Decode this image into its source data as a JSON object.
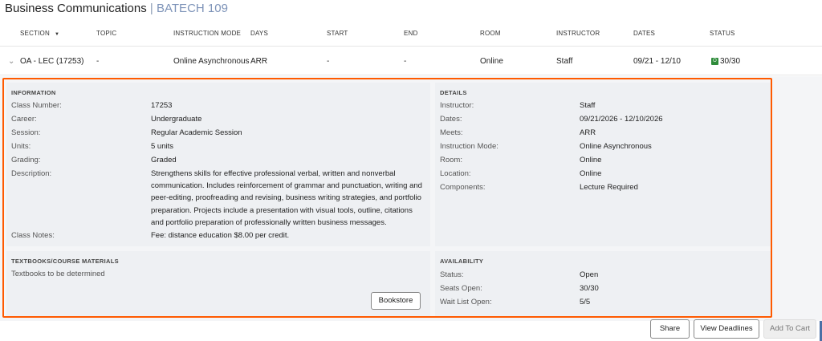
{
  "course": {
    "name": "Business Communications",
    "separator": "|",
    "code": "BATECH 109"
  },
  "columns": {
    "section": "SECTION",
    "topic": "TOPIC",
    "instruction_mode": "INSTRUCTION MODE",
    "days": "DAYS",
    "start": "START",
    "end": "END",
    "room": "ROOM",
    "instructor": "INSTRUCTOR",
    "dates": "DATES",
    "status": "STATUS"
  },
  "row": {
    "section": "OA - LEC (17253)",
    "topic": "-",
    "instruction_mode": "Online Asynchronous",
    "days": "ARR",
    "start": "-",
    "end": "-",
    "room": "Online",
    "instructor": "Staff",
    "dates": "09/21 - 12/10",
    "status_icon_letter": "O",
    "status": "30/30"
  },
  "information": {
    "title": "INFORMATION",
    "class_number_label": "Class Number:",
    "class_number": "17253",
    "career_label": "Career:",
    "career": "Undergraduate",
    "session_label": "Session:",
    "session": "Regular Academic Session",
    "units_label": "Units:",
    "units": "5 units",
    "grading_label": "Grading:",
    "grading": "Graded",
    "description_label": "Description:",
    "description": "Strengthens skills for effective professional verbal, written and nonverbal communication. Includes reinforcement of grammar and punctuation, writing and peer-editing, proofreading and revising, business writing strategies, and portfolio preparation. Projects include a presentation with visual tools, outline, citations and portfolio preparation of professionally written business messages.",
    "class_notes_label": "Class Notes:",
    "class_notes": "Fee: distance education $8.00 per credit."
  },
  "details": {
    "title": "DETAILS",
    "instructor_label": "Instructor:",
    "instructor": "Staff",
    "dates_label": "Dates:",
    "dates": "09/21/2026 - 12/10/2026",
    "meets_label": "Meets:",
    "meets": "ARR",
    "mode_label": "Instruction Mode:",
    "mode": "Online Asynchronous",
    "room_label": "Room:",
    "room": "Online",
    "location_label": "Location:",
    "location": "Online",
    "components_label": "Components:",
    "components": "Lecture Required"
  },
  "textbooks": {
    "title": "TEXTBOOKS/COURSE MATERIALS",
    "text": "Textbooks to be determined",
    "bookstore_button": "Bookstore"
  },
  "availability": {
    "title": "AVAILABILITY",
    "status_label": "Status:",
    "status": "Open",
    "seats_label": "Seats Open:",
    "seats": "30/30",
    "waitlist_label": "Wait List Open:",
    "waitlist": "5/5"
  },
  "actions": {
    "share": "Share",
    "view_deadlines": "View Deadlines",
    "add_to_cart": "Add To Cart"
  },
  "colors": {
    "highlight": "#ff5a00",
    "status_open": "#2e8b3a",
    "course_code": "#7d93b8"
  },
  "icons": {
    "expand": "chevron-down-icon",
    "sort": "sort-down-icon",
    "status": "open-status-icon"
  }
}
